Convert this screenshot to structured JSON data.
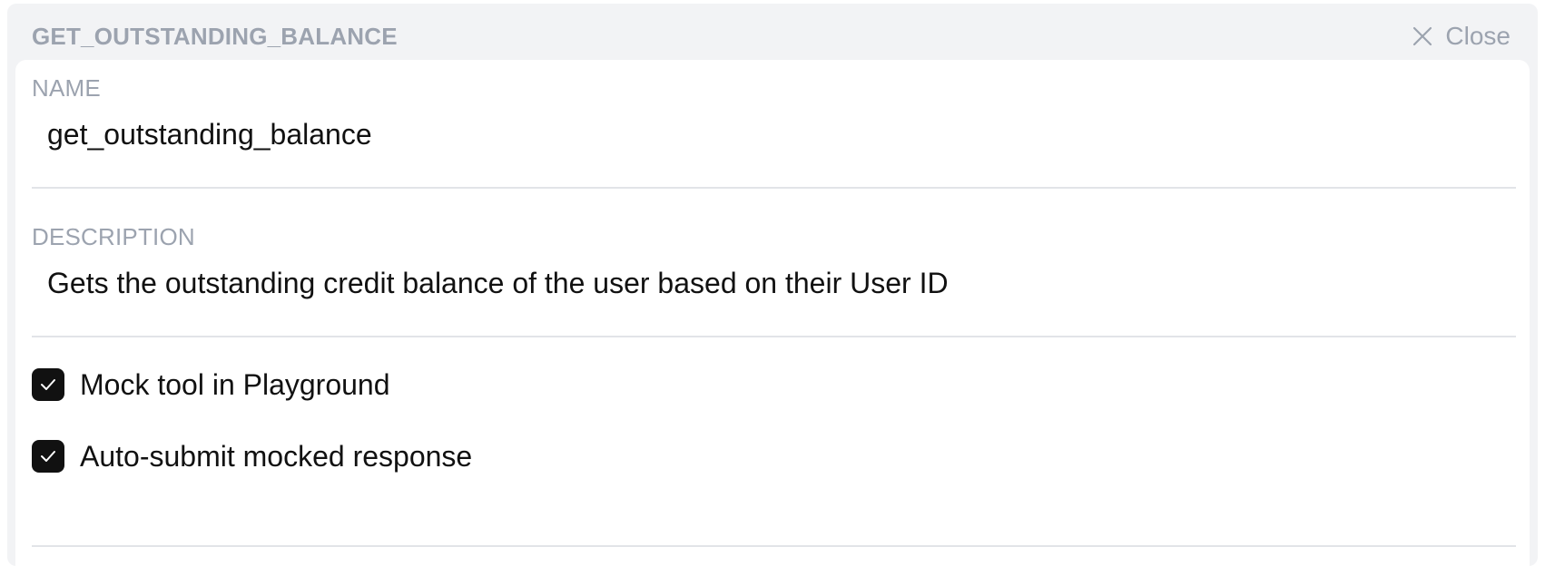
{
  "panel": {
    "title": "GET_OUTSTANDING_BALANCE",
    "close_label": "Close"
  },
  "form": {
    "name": {
      "label": "NAME",
      "value": "get_outstanding_balance"
    },
    "description": {
      "label": "DESCRIPTION",
      "value": "Gets the outstanding credit balance of the user based on their User ID"
    },
    "options": [
      {
        "label": "Mock tool in Playground",
        "checked": true
      },
      {
        "label": "Auto-submit mocked response",
        "checked": true
      }
    ]
  },
  "colors": {
    "panel_bg": "#f2f3f5",
    "muted_text": "#9ca3af",
    "checkbox_fill": "#111111",
    "divider": "#e2e4e8"
  },
  "icons": {
    "close": "close-icon",
    "check": "checkmark-icon"
  }
}
